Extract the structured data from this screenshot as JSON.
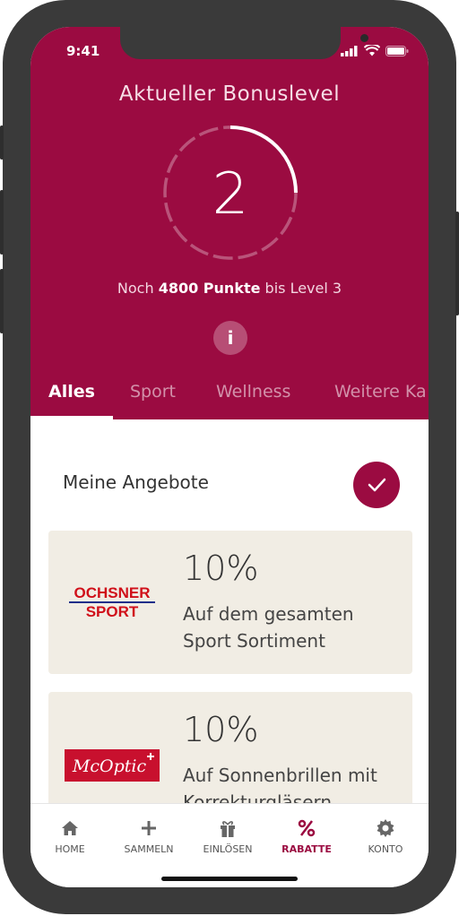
{
  "status_bar": {
    "time": "9:41"
  },
  "hero": {
    "title": "Aktueller Bonuslevel",
    "level": "2",
    "progress": 0.25,
    "points_prefix": "Noch ",
    "points_bold": "4800 Punkte",
    "points_suffix": " bis Level 3",
    "info_label": "i"
  },
  "tabs": [
    "Alles",
    "Sport",
    "Wellness",
    "Weitere Ka"
  ],
  "offers": {
    "title": "Meine Angebote",
    "cards": [
      {
        "logo_text_1": "OCHSNER",
        "logo_text_2": "SPORT",
        "percent": "10%",
        "description": "Auf dem gesamten Sport Sortiment"
      },
      {
        "logo_text": "McOptic",
        "percent": "10%",
        "description": "Auf Sonnenbrillen mit Korrekturgläsern"
      }
    ]
  },
  "tabbar": {
    "items": [
      {
        "label": "HOME",
        "icon": "home-icon"
      },
      {
        "label": "SAMMELN",
        "icon": "plus-icon"
      },
      {
        "label": "EINLÖSEN",
        "icon": "gift-icon"
      },
      {
        "label": "RABATTE",
        "icon": "percent-icon"
      },
      {
        "label": "KONTO",
        "icon": "gear-icon"
      }
    ]
  },
  "colors": {
    "brand": "#9b0b41",
    "card_bg": "#f1ede4"
  }
}
